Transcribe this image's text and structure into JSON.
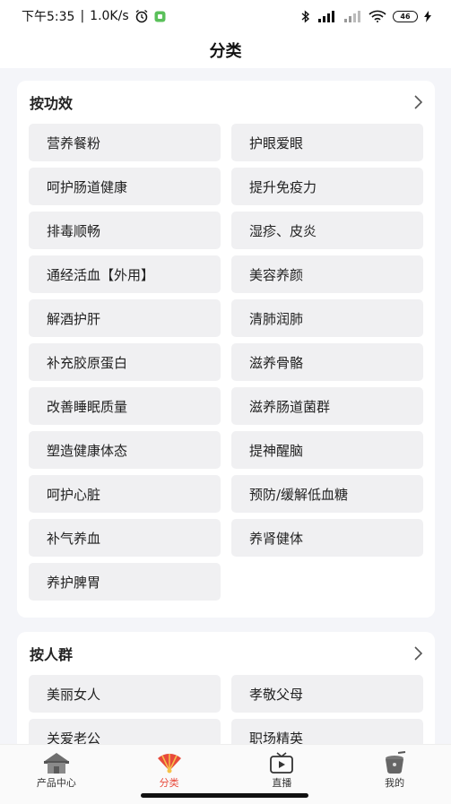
{
  "status_bar": {
    "time": "下午5:35",
    "speed": "1.0K/s",
    "battery": "46"
  },
  "header": {
    "title": "分类"
  },
  "sections": [
    {
      "title": "按功效",
      "items": [
        "营养餐粉",
        "护眼爱眼",
        "呵护肠道健康",
        "提升免疫力",
        "排毒顺畅",
        "湿疹、皮炎",
        "通经活血【外用】",
        "美容养颜",
        "解酒护肝",
        "清肺润肺",
        "补充胶原蛋白",
        "滋养骨骼",
        "改善睡眠质量",
        "滋养肠道菌群",
        "塑造健康体态",
        "提神醒脑",
        "呵护心脏",
        "预防/缓解低血糖",
        "补气养血",
        "养肾健体",
        "养护脾胃"
      ]
    },
    {
      "title": "按人群",
      "items": [
        "美丽女人",
        "孝敬父母",
        "关爱老公",
        "职场精英"
      ]
    }
  ],
  "tabbar": {
    "tabs": [
      {
        "label": "产品中心",
        "icon": "house-icon"
      },
      {
        "label": "分类",
        "icon": "fan-category-icon"
      },
      {
        "label": "直播",
        "icon": "tv-play-icon"
      },
      {
        "label": "我的",
        "icon": "pot-icon"
      }
    ],
    "active_color": "#e84a3c"
  }
}
